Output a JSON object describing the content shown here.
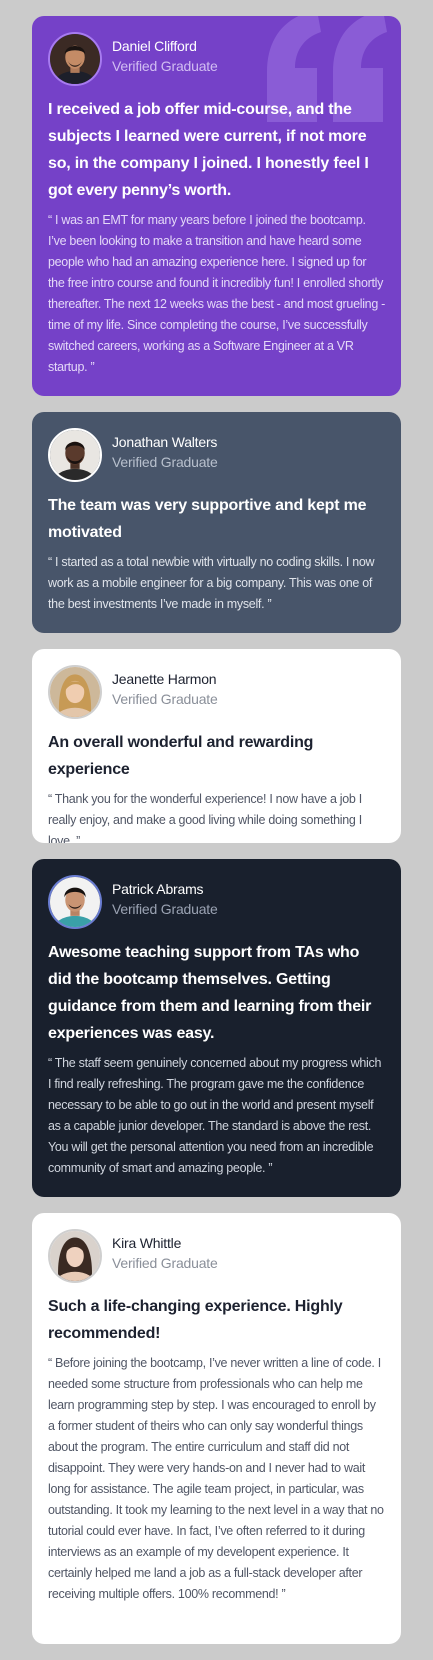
{
  "testimonials": [
    {
      "name": "Daniel Clifford",
      "role": "Verified Graduate",
      "headline": "I received a job offer mid-course, and the subjects I learned were current, if not more so, in the company I joined. I honestly feel I got every penny’s worth.",
      "quote": "“ I was an EMT for many years before I joined the bootcamp. I’ve been looking to make a transition and have heard some people who had an amazing experience here. I signed up for the free intro course and found it incredibly fun! I enrolled shortly thereafter. The next 12 weeks was the best - and most grueling - time of my life. Since completing the course, I’ve successfully switched careers, working as a Software Engineer at a VR startup. ”",
      "theme": "#7541c8",
      "icon": "quote-icon"
    },
    {
      "name": "Jonathan Walters",
      "role": "Verified Graduate",
      "headline": "The team was very supportive and kept me motivated",
      "quote": "“ I started as a total newbie with virtually no coding skills. I now work as a mobile engineer for a big company. This was one of the best investments I’ve made in myself. ”",
      "theme": "#48556a"
    },
    {
      "name": "Jeanette Harmon",
      "role": "Verified Graduate",
      "headline": "An overall wonderful and rewarding experience",
      "quote": "“ Thank you for the wonderful experience! I now have a job I really enjoy, and make a good living while doing something I love. ”",
      "theme": "#ffffff"
    },
    {
      "name": "Patrick Abrams",
      "role": "Verified Graduate",
      "headline": "Awesome teaching support from TAs who did the bootcamp themselves. Getting guidance from them and learning from their experiences was easy.",
      "quote": "“ The staff seem genuinely concerned about my progress which I find really refreshing. The program gave me the confidence necessary to be able to go out in the world and present myself as a capable junior developer. The standard is above the rest. You will get the personal attention you need from an incredible community of smart and amazing people. ”",
      "theme": "#19202d"
    },
    {
      "name": "Kira Whittle",
      "role": "Verified Graduate",
      "headline": "Such a life-changing experience. Highly recommended!",
      "quote": "“ Before joining the bootcamp, I’ve never written a line of code. I needed some structure from professionals who can help me learn programming step by step. I was encouraged to enroll by a former student of theirs who can only say wonderful things about the program. The entire curriculum and staff did not disappoint. They were very hands-on and I never had to wait long for assistance. The agile team project, in particular, was outstanding. It took my learning to the next level in a way that no tutorial could ever have. In fact, I’ve often referred to it during interviews as an example of my developent experience. It certainly helped me land a job as a full-stack developer after receiving multiple offers. 100% recommend! ”",
      "theme": "#ffffff"
    }
  ]
}
